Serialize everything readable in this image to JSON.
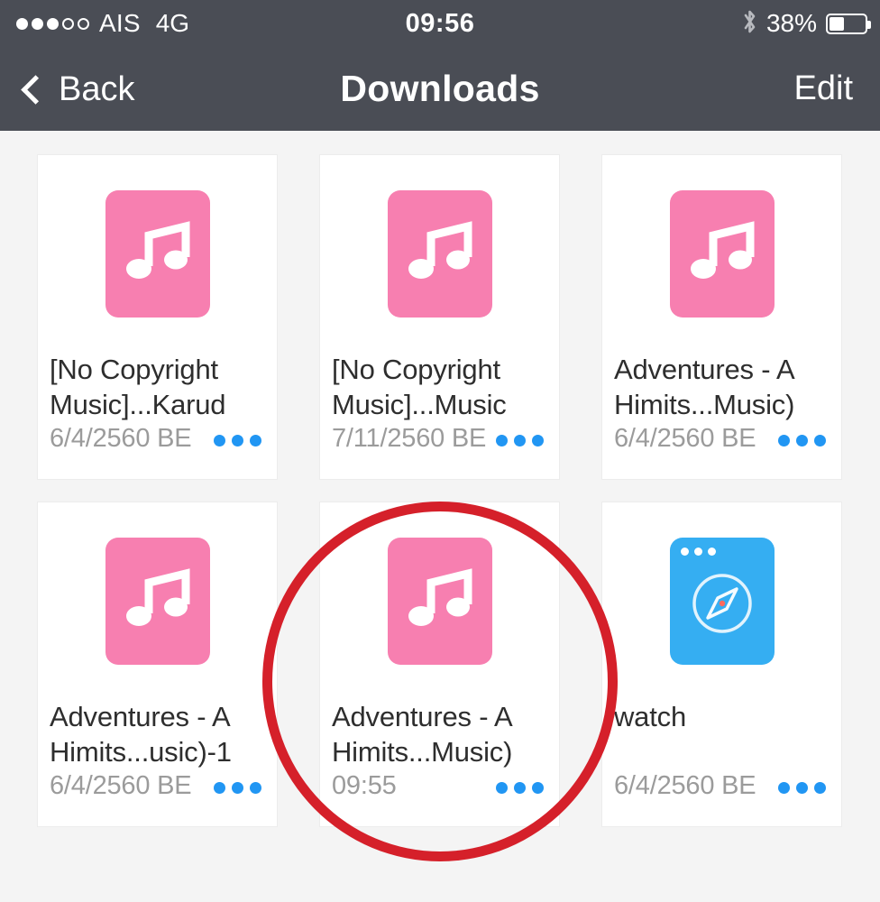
{
  "status_bar": {
    "signal_dots_total": 5,
    "signal_dots_filled": 3,
    "carrier": "AIS",
    "network": "4G",
    "time": "09:56",
    "bluetooth_icon": "bluetooth-icon",
    "battery_percent": "38%",
    "battery_level": 38
  },
  "nav_bar": {
    "back_label": "Back",
    "back_icon": "chevron-left-icon",
    "title": "Downloads",
    "edit_label": "Edit"
  },
  "colors": {
    "nav_background": "#4a4d55",
    "page_background": "#f4f4f4",
    "card_background": "#ffffff",
    "music_icon": "#f77fb0",
    "browser_icon": "#35aef2",
    "more_dots": "#2196f3",
    "annotation": "#d5202a",
    "title_text": "#2e2e2e",
    "date_text": "#9b9b9b"
  },
  "files": [
    {
      "icon": "music-file-icon",
      "title": "[No Copyright Music]...Karud",
      "date": "6/4/2560 BE",
      "more_icon": "more-dots-icon",
      "highlighted": false
    },
    {
      "icon": "music-file-icon",
      "title": "[No Copyright Music]...Music",
      "date": "7/11/2560 BE",
      "more_icon": "more-dots-icon",
      "highlighted": false
    },
    {
      "icon": "music-file-icon",
      "title": "Adventures - A Himits...Music)",
      "date": "6/4/2560 BE",
      "more_icon": "more-dots-icon",
      "highlighted": false
    },
    {
      "icon": "music-file-icon",
      "title": "Adventures - A Himits...usic)-1",
      "date": "6/4/2560 BE",
      "more_icon": "more-dots-icon",
      "highlighted": false
    },
    {
      "icon": "music-file-icon",
      "title": "Adventures - A Himits...Music)",
      "date": "09:55",
      "more_icon": "more-dots-icon",
      "highlighted": true
    },
    {
      "icon": "browser-file-icon",
      "title": "watch",
      "date": "6/4/2560 BE",
      "more_icon": "more-dots-icon",
      "highlighted": false
    }
  ],
  "annotation": {
    "shape": "circle",
    "target_index": 4
  }
}
